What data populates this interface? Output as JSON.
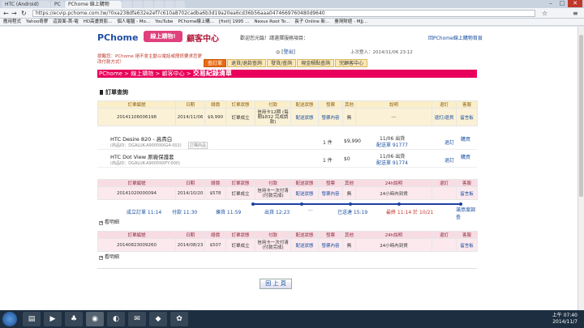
{
  "browser": {
    "tabs": [
      {
        "label": "HTC (Android)",
        "active": false
      },
      {
        "label": "PC",
        "active": false
      },
      {
        "label": "PChome 線上購物",
        "active": true
      },
      {
        "label": "",
        "active": false
      },
      {
        "label": "",
        "active": false
      },
      {
        "label": "",
        "active": false
      },
      {
        "label": "",
        "active": false
      },
      {
        "label": "",
        "active": false
      },
      {
        "label": "",
        "active": false
      }
    ],
    "url": "https://ecvip.pchome.com.tw/?0xa238dfa632e2ef7c610a8702cadba6b3d19a20ea6cd36b56aaa0474669760480d9640",
    "bookmarks": [
      "應用程式",
      "Yahoo奇摩",
      "這頁面-首-電",
      "HD高畫質影...",
      "個人電腦 - Mo...",
      "YouTube",
      "PChome線上購...",
      "[fixit] 1995 ...",
      "Nexus Root To...",
      "長子 Online 新...",
      "臺灣財經 - MJJ..."
    ]
  },
  "header": {
    "logo": "PChome",
    "badge": "線上購物!",
    "center_title": "顧客中心",
    "welcome": "歡迎您光臨！請選擇服務項目：",
    "mall_link": "回PChome線上購物首頁",
    "login_prefix": "◎",
    "logout": "登出",
    "last_login": "上次登入：2014/11/06 23:12",
    "promo": "提醒您：PChome 絕不會主動以電話或簡訊要求您更改付款方式！"
  },
  "nav_tabs": [
    "查訂單",
    "退貨/退款查詢",
    "發貨/查詢",
    "現金積點查詢",
    "完顧客中心"
  ],
  "breadcrumb": {
    "prefix": "PChome > 線上購物 > 顧客中心 > ",
    "current": "交易紀錄清單"
  },
  "section_title": "訂單查詢",
  "order1": {
    "headers": [
      "訂單編號",
      "日期",
      "總價",
      "訂單狀態",
      "付款",
      "配送狀態",
      "發票",
      "其他",
      "說明",
      "退訂",
      "客服"
    ],
    "row": [
      "20141106006198",
      "2014/11/06",
      "$9,990",
      "訂單成立",
      "信用卡12期 (每期$832 完成請款)",
      "配送狀態",
      "發票內容",
      "無",
      "---",
      "退訂/退貨",
      "留言板"
    ],
    "items": [
      {
        "name": "HTC Desire 820 - 高貴白",
        "id": "(商品ID：DGALUK-A9005NXG4-002)",
        "tag": "訂購商品",
        "qty": "1 件",
        "price": "$9,990",
        "ship": "11/06 出貨",
        "track": "配送單 91777",
        "action": "退訂",
        "action2": "購買"
      },
      {
        "name": "HTC Dot View 原廠保護套",
        "id": "(商品ID：DGALUK-A9005NXFY-000)",
        "tag": "",
        "qty": "1 件",
        "price": "$0",
        "ship": "11/06 出貨",
        "track": "配送單 91774",
        "action": "退訂",
        "action2": "購買"
      }
    ]
  },
  "order2": {
    "headers": [
      "訂單編號",
      "日期",
      "總價",
      "訂單狀態",
      "付款",
      "配送狀態",
      "發票",
      "其他",
      "24h說明",
      "退訂",
      "客服"
    ],
    "row": [
      "20141020000094",
      "2014/10/20",
      "$578",
      "訂單成立",
      "信用卡一次付清 (付款完成)",
      "配送狀態",
      "發票內容",
      "無",
      "24小時內到貨",
      "",
      "留言板"
    ],
    "timeline": [
      "成立訂單 11:14",
      "付款 11:30",
      "揀貨 11:59",
      "出貨 12:23",
      "···",
      "已送達 15:19",
      "最終 11:14 於 10/21"
    ],
    "toggle": "看明細",
    "feedback": "滿意度調查"
  },
  "order3": {
    "headers": [
      "訂單編號",
      "日期",
      "總價",
      "訂單狀態",
      "付款",
      "配送狀態",
      "發票",
      "其他",
      "24h說明",
      "退訂",
      "客服"
    ],
    "row": [
      "20140823009260",
      "2014/08/23",
      "$507",
      "訂單成立",
      "信用卡一次付清 (付款完成)",
      "配送狀態",
      "發票內容",
      "無",
      "24小時內到貨",
      "",
      "留言板"
    ],
    "toggle": "看明細"
  },
  "back_button": "回 上 頁",
  "taskbar": {
    "time": "上午 07:40",
    "date": "2014/11/7"
  },
  "colors": {
    "brand_pink": "#e8005a",
    "brand_blue": "#1f4fa5",
    "nav_orange": "#e86a10"
  }
}
